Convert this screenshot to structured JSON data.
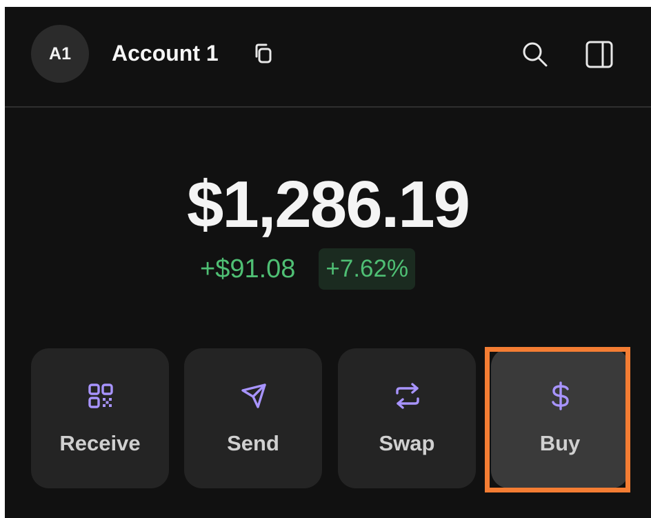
{
  "header": {
    "avatar_initials": "A1",
    "account_name": "Account 1",
    "icons": {
      "copy": "copy-icon",
      "search": "search-icon",
      "sidebar": "sidebar-toggle-icon"
    }
  },
  "portfolio": {
    "balance": "$1,286.19",
    "change_amount": "+$91.08",
    "change_percent": "+7.62%"
  },
  "actions": [
    {
      "label": "Receive",
      "icon": "qr-code-icon"
    },
    {
      "label": "Send",
      "icon": "send-icon"
    },
    {
      "label": "Swap",
      "icon": "swap-icon"
    },
    {
      "label": "Buy",
      "icon": "dollar-icon"
    }
  ],
  "colors": {
    "background": "#111111",
    "accent": "#a894ff",
    "positive": "#4fbf74",
    "highlight_outline": "#f47d33"
  }
}
